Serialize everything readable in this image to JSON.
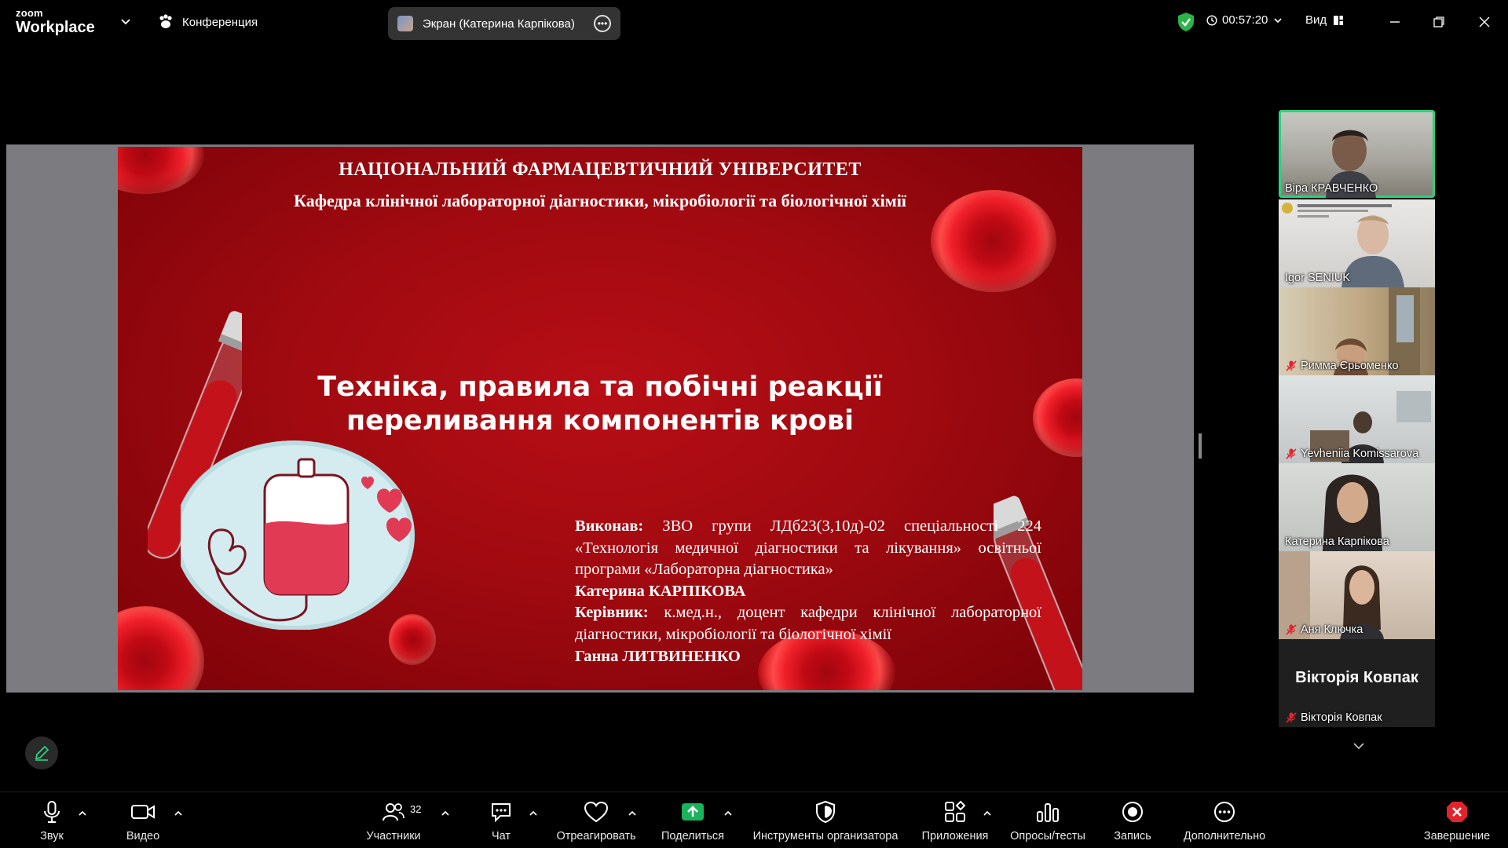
{
  "app": {
    "logo_top": "zoom",
    "logo_bottom": "Workplace",
    "meeting_label": "Конференция",
    "share_title": "Экран (Катерина Карпікова)",
    "timer": "00:57:20",
    "view_label": "Вид"
  },
  "slide": {
    "university": "НАЦІОНАЛЬНИЙ ФАРМАЦЕВТИЧНИЙ УНІВЕРСИТЕТ",
    "department": "Кафедра клінічної лабораторної діагностики, мікробіології та біологічної хімії",
    "title_line1": "Техніка, правила та побічні реакції",
    "title_line2": "переливання компонентів крові",
    "performer_label": "Виконав:",
    "performer_text": "ЗВО групи ЛДб23(3,10д)-02 спеціальності 224 «Технологія медичної діагностики та лікування» освітньої програми «Лабораторна діагностика»",
    "performer_name": "Катерина КАРПІКОВА",
    "supervisor_label": "Керівник:",
    "supervisor_text": "к.мед.н., доцент кафедри клінічної лабораторної діагностики, мікробіології та біологічної хімії",
    "supervisor_name": "Ганна ЛИТВИНЕНКО"
  },
  "participants": [
    {
      "name": "Віра КРАВЧЕНКО",
      "muted": false,
      "active": true
    },
    {
      "name": "Igor SENIUK",
      "muted": false,
      "active": false
    },
    {
      "name": "Римма Єрьоменко",
      "muted": true,
      "active": false
    },
    {
      "name": "Yevheniia Komissarova",
      "muted": true,
      "active": false
    },
    {
      "name": "Катерина Карпікова",
      "muted": false,
      "active": false
    },
    {
      "name": "Аня Ключка",
      "muted": true,
      "active": false
    },
    {
      "name": "Вікторія Ковпак",
      "muted": true,
      "active": false,
      "avatar_text": "Вікторія Ковпак"
    }
  ],
  "toolbar": {
    "audio": "Звук",
    "video": "Видео",
    "participants": "Участники",
    "participants_count": "32",
    "chat": "Чат",
    "react": "Отреагировать",
    "share": "Поделиться",
    "host_tools": "Инструменты организатора",
    "apps": "Приложения",
    "polls": "Опросы/тесты",
    "record": "Запись",
    "more": "Дополнительно",
    "end": "Завершение"
  },
  "colors": {
    "accent_green": "#2bd17e",
    "share_green": "#18b35a",
    "end_red": "#e0242e",
    "slide_red": "#a00a10"
  }
}
